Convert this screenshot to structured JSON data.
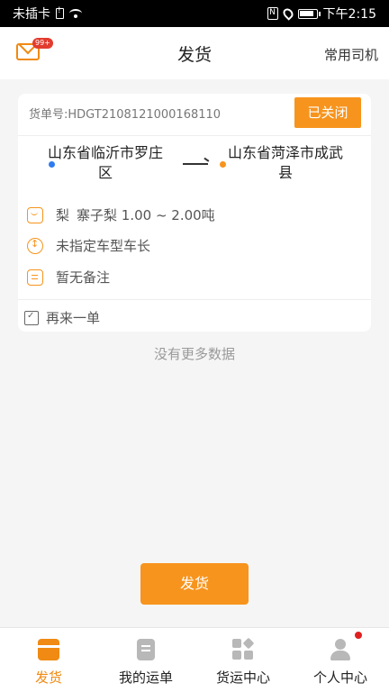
{
  "status_bar": {
    "carrier": "未插卡",
    "time": "下午2:15"
  },
  "header": {
    "title": "发货",
    "right_action": "常用司机",
    "badge": "99+"
  },
  "order": {
    "order_no": "货单号:HDGT2108121000168110",
    "status": "已关闭",
    "from": "山东省临沂市罗庄区",
    "to": "山东省菏泽市成武县",
    "cargo_name": "梨",
    "cargo_detail": "寨子梨 1.00 ~ 2.00吨",
    "vehicle": "未指定车型车长",
    "remark": "暂无备注",
    "reorder": "再来一单"
  },
  "no_more": "没有更多数据",
  "primary_button": "发货",
  "tabs": [
    {
      "label": "发货",
      "icon": "ship-tab-icon",
      "active": true
    },
    {
      "label": "我的运单",
      "icon": "orders-tab-icon",
      "active": false
    },
    {
      "label": "货运中心",
      "icon": "freight-center-tab-icon",
      "active": false
    },
    {
      "label": "个人中心",
      "icon": "person-tab-icon",
      "active": false
    }
  ],
  "colors": {
    "accent": "#f7941d",
    "blue_dot": "#2f7bf0"
  }
}
